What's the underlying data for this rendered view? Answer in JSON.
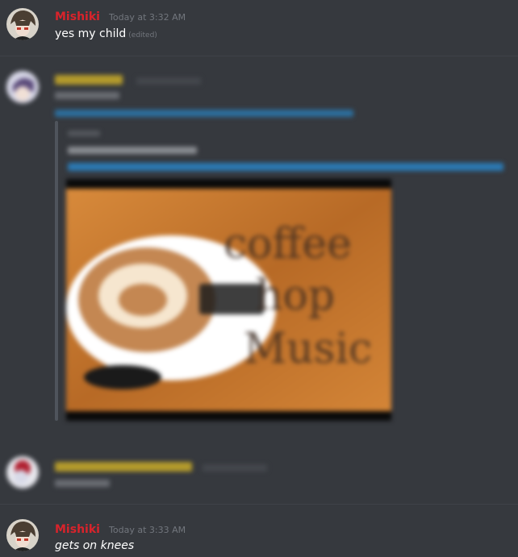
{
  "messages": [
    {
      "author": "Mishiki",
      "author_color": "#d9232b",
      "timestamp": "Today at 3:32 AM",
      "text": "yes my child",
      "edited_label": "(edited)"
    },
    {
      "author": "",
      "timestamp": "",
      "blurred": true,
      "embed": {
        "image_caption": ""
      }
    },
    {
      "author": "",
      "timestamp": "",
      "blurred": true
    },
    {
      "author": "Mishiki",
      "author_color": "#d9232b",
      "timestamp": "Today at 3:33 AM",
      "text": "gets on knees",
      "italic": true
    }
  ]
}
